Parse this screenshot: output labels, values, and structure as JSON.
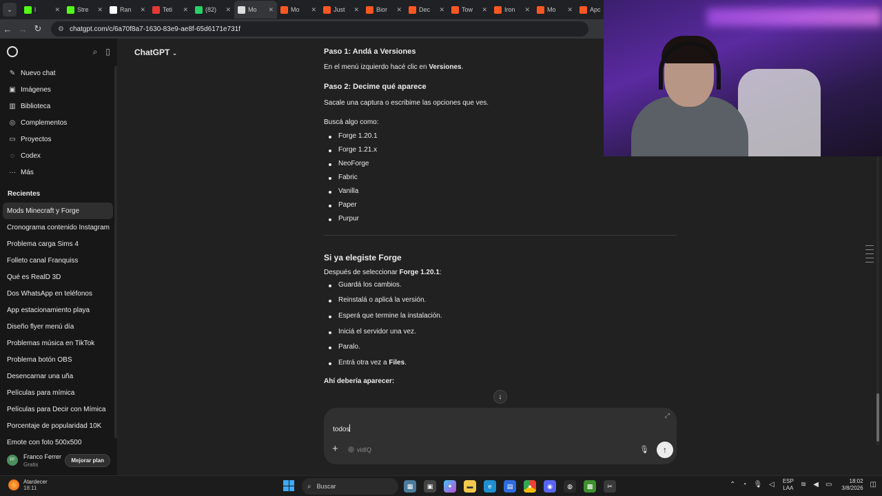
{
  "browser": {
    "tabs": [
      {
        "label": "l",
        "color": "#53fc18"
      },
      {
        "label": "Stre",
        "color": "#53fc18"
      },
      {
        "label": "Ran",
        "color": "#ffffff"
      },
      {
        "label": "Teti",
        "color": "#e53935"
      },
      {
        "label": "(82)",
        "color": "#25d366"
      },
      {
        "label": "Mo",
        "color": "#dddddd",
        "active": true
      },
      {
        "label": "Mo",
        "color": "#ff5722"
      },
      {
        "label": "Just",
        "color": "#ff5722"
      },
      {
        "label": "Bior",
        "color": "#ff5722"
      },
      {
        "label": "Dec",
        "color": "#ff5722"
      },
      {
        "label": "Tow",
        "color": "#ff5722"
      },
      {
        "label": "Iron",
        "color": "#ff5722"
      },
      {
        "label": "Mo",
        "color": "#ff5722"
      },
      {
        "label": "Apc",
        "color": "#ff5722"
      }
    ],
    "url": "chatgpt.com/c/6a70f8a7-1630-83e9-ae8f-65d6171e731f"
  },
  "sidebar": {
    "nav": [
      {
        "icon": "✎",
        "label": "Nuevo chat"
      },
      {
        "icon": "▣",
        "label": "Imágenes"
      },
      {
        "icon": "▥",
        "label": "Biblioteca"
      },
      {
        "icon": "◎",
        "label": "Complementos"
      },
      {
        "icon": "▭",
        "label": "Proyectos"
      },
      {
        "icon": "◌",
        "label": "Codex"
      },
      {
        "icon": "···",
        "label": "Más"
      }
    ],
    "recent_title": "Recientes",
    "recents": [
      "Mods Minecraft y Forge",
      "Cronograma contenido Instagram",
      "Problema carga Sims 4",
      "Folleto canal Franquiss",
      "Qué es RealD 3D",
      "Dos WhatsApp en teléfonos",
      "App estacionamiento playa",
      "Diseño flyer menú día",
      "Problemas música en TikTok",
      "Problema botón OBS",
      "Desencarnar una uña",
      "Películas para mímica",
      "Películas para Decir con Mímica",
      "Porcentaje de popularidad 10K",
      "Emote con foto 500x500"
    ],
    "user": {
      "initials": "FF",
      "name": "Franco Ferrer",
      "plan": "Gratis",
      "upgrade": "Mejorar plan"
    }
  },
  "main": {
    "model": "ChatGPT",
    "step1_title": "Paso 1: Andá a Versiones",
    "step1_text_a": "En el menú izquierdo hacé clic en ",
    "step1_text_b": "Versiones",
    "step1_text_c": ".",
    "step2_title": "Paso 2: Decime qué aparece",
    "step2_text": "Sacale una captura o escribime las opciones que ves.",
    "look_for": "Buscá algo como:",
    "options": [
      "Forge 1.20.1",
      "Forge 1.21.x",
      "NeoForge",
      "Fabric",
      "Vanilla",
      "Paper",
      "Purpur"
    ],
    "forge_title": "Si ya elegiste Forge",
    "forge_intro_a": "Después de seleccionar ",
    "forge_intro_b": "Forge 1.20.1",
    "forge_intro_c": ":",
    "forge_steps": [
      "Guardá los cambios.",
      "Reinstalá o aplicá la versión.",
      "Esperá que termine la instalación.",
      "Iniciá el servidor una vez.",
      "Paralo."
    ],
    "forge_last_a": "Entrá otra vez a ",
    "forge_last_b": "Files",
    "forge_last_c": ".",
    "should_appear": "Ahí debería aparecer:",
    "composer": {
      "value": "todos",
      "extension": "vidIQ"
    }
  },
  "taskbar": {
    "weather_title": "Atardecer",
    "weather_time": "18:11",
    "search_placeholder": "Buscar",
    "lang_1": "ESP",
    "lang_2": "LAA",
    "time": "18:02",
    "date": "3/8/2026"
  }
}
